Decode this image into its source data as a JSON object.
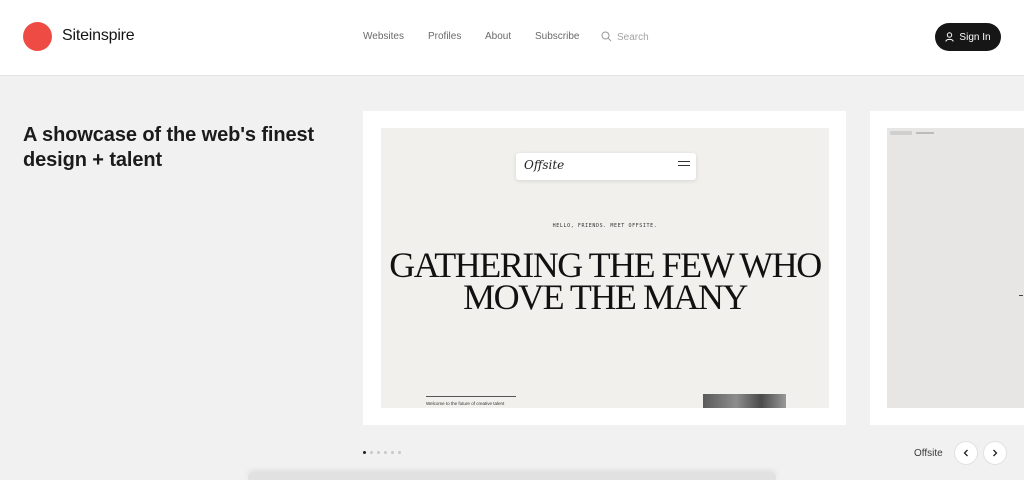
{
  "brand": {
    "name": "Siteinspire",
    "accent": "#ee4b45"
  },
  "nav": {
    "items": [
      "Websites",
      "Profiles",
      "About",
      "Subscribe"
    ],
    "search_placeholder": "Search",
    "search_icon": "search-icon",
    "sign_in": "Sign In",
    "sign_in_icon": "user-icon"
  },
  "hero": {
    "tagline": "A showcase of the web's finest design + talent"
  },
  "featured": {
    "site_logo": "Offsite",
    "kicker": "HELLO, FRIENDS. MEET OFFSITE.",
    "headline": "GATHERING THE FEW WHO MOVE THE MANY",
    "welcome_text": "Welcome to the future of creative talent"
  },
  "carousel": {
    "current_name": "Offsite",
    "slide_count": 6,
    "active_index": 0,
    "prev_icon": "chevron-left-icon",
    "next_icon": "chevron-right-icon"
  }
}
